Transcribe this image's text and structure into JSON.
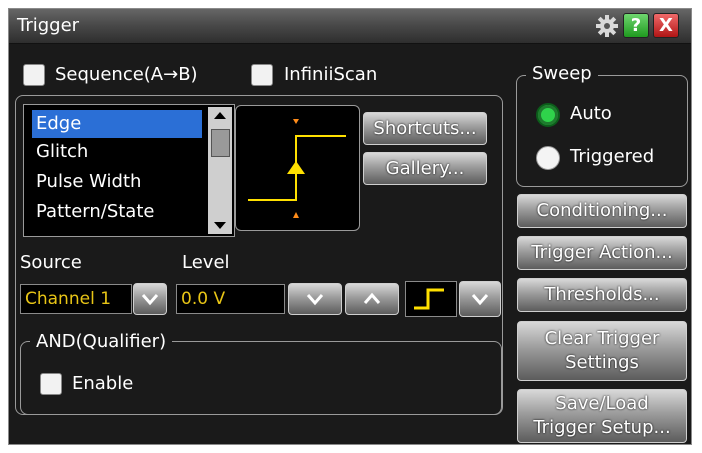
{
  "window": {
    "title": "Trigger"
  },
  "title_buttons": {
    "help": "?",
    "close": "X"
  },
  "options": {
    "sequence": "Sequence(A→B)",
    "infiniiscan": "InfiniiScan"
  },
  "trigger_types": [
    "Edge",
    "Glitch",
    "Pulse Width",
    "Pattern/State"
  ],
  "selected_type": "Edge",
  "buttons": {
    "shortcuts": "Shortcuts...",
    "gallery": "Gallery...",
    "conditioning": "Conditioning...",
    "trigger_action": "Trigger Action...",
    "thresholds": "Thresholds...",
    "clear_line1": "Clear Trigger",
    "clear_line2": "Settings",
    "saveload_line1": "Save/Load",
    "saveload_line2": "Trigger Setup..."
  },
  "sweep": {
    "title": "Sweep",
    "auto": "Auto",
    "triggered": "Triggered",
    "selected": "Auto"
  },
  "source": {
    "label": "Source",
    "value": "Channel 1"
  },
  "level": {
    "label": "Level",
    "value": "0.0 V"
  },
  "qualifier": {
    "title": "AND(Qualifier)",
    "enable": "Enable"
  },
  "colors": {
    "field_text": "#e8c516",
    "edge_yellow": "#ffe000",
    "marker_orange": "#ff8c1a",
    "selection": "#2b6fd6",
    "radio_on": "#2fd34b"
  },
  "icons": {
    "settings": "gear-icon",
    "slope": "rising-edge-icon"
  }
}
